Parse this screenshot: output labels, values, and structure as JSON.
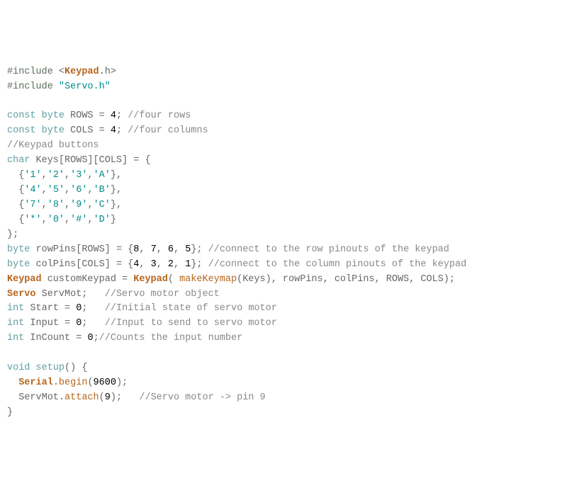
{
  "lines": [
    [
      [
        "preproc",
        "#include"
      ],
      [
        "ident",
        " "
      ],
      [
        "ltgt",
        "<"
      ],
      [
        "cls",
        "Keypad"
      ],
      [
        "ident",
        ".h"
      ],
      [
        "ltgt",
        ">"
      ]
    ],
    [
      [
        "preproc",
        "#include"
      ],
      [
        "ident",
        " "
      ],
      [
        "str",
        "\"Servo.h\""
      ]
    ],
    [],
    [
      [
        "kw",
        "const"
      ],
      [
        "ident",
        " "
      ],
      [
        "kw",
        "byte"
      ],
      [
        "ident",
        " ROWS "
      ],
      [
        "op",
        "="
      ],
      [
        "ident",
        " "
      ],
      [
        "num",
        "4"
      ],
      [
        "op",
        ";"
      ],
      [
        "ident",
        " "
      ],
      [
        "comment",
        "//four rows"
      ]
    ],
    [
      [
        "kw",
        "const"
      ],
      [
        "ident",
        " "
      ],
      [
        "kw",
        "byte"
      ],
      [
        "ident",
        " COLS "
      ],
      [
        "op",
        "="
      ],
      [
        "ident",
        " "
      ],
      [
        "num",
        "4"
      ],
      [
        "op",
        ";"
      ],
      [
        "ident",
        " "
      ],
      [
        "comment",
        "//four columns"
      ]
    ],
    [
      [
        "comment",
        "//Keypad buttons"
      ]
    ],
    [
      [
        "kw",
        "char"
      ],
      [
        "ident",
        " Keys[ROWS][COLS] "
      ],
      [
        "op",
        "="
      ],
      [
        "ident",
        " "
      ],
      [
        "op",
        "{"
      ]
    ],
    [
      [
        "ident",
        "  "
      ],
      [
        "op",
        "{"
      ],
      [
        "str",
        "'1'"
      ],
      [
        "op",
        ","
      ],
      [
        "str",
        "'2'"
      ],
      [
        "op",
        ","
      ],
      [
        "str",
        "'3'"
      ],
      [
        "op",
        ","
      ],
      [
        "str",
        "'A'"
      ],
      [
        "op",
        "},"
      ]
    ],
    [
      [
        "ident",
        "  "
      ],
      [
        "op",
        "{"
      ],
      [
        "str",
        "'4'"
      ],
      [
        "op",
        ","
      ],
      [
        "str",
        "'5'"
      ],
      [
        "op",
        ","
      ],
      [
        "str",
        "'6'"
      ],
      [
        "op",
        ","
      ],
      [
        "str",
        "'B'"
      ],
      [
        "op",
        "},"
      ]
    ],
    [
      [
        "ident",
        "  "
      ],
      [
        "op",
        "{"
      ],
      [
        "str",
        "'7'"
      ],
      [
        "op",
        ","
      ],
      [
        "str",
        "'8'"
      ],
      [
        "op",
        ","
      ],
      [
        "str",
        "'9'"
      ],
      [
        "op",
        ","
      ],
      [
        "str",
        "'C'"
      ],
      [
        "op",
        "},"
      ]
    ],
    [
      [
        "ident",
        "  "
      ],
      [
        "op",
        "{"
      ],
      [
        "str",
        "'*'"
      ],
      [
        "op",
        ","
      ],
      [
        "str",
        "'0'"
      ],
      [
        "op",
        ","
      ],
      [
        "str",
        "'#'"
      ],
      [
        "op",
        ","
      ],
      [
        "str",
        "'D'"
      ],
      [
        "op",
        "}"
      ]
    ],
    [
      [
        "op",
        "};"
      ]
    ],
    [
      [
        "kw",
        "byte"
      ],
      [
        "ident",
        " rowPins[ROWS] "
      ],
      [
        "op",
        "="
      ],
      [
        "ident",
        " "
      ],
      [
        "op",
        "{"
      ],
      [
        "num",
        "8"
      ],
      [
        "op",
        ", "
      ],
      [
        "num",
        "7"
      ],
      [
        "op",
        ", "
      ],
      [
        "num",
        "6"
      ],
      [
        "op",
        ", "
      ],
      [
        "num",
        "5"
      ],
      [
        "op",
        "};"
      ],
      [
        "ident",
        " "
      ],
      [
        "comment",
        "//connect to the row pinouts of the keypad"
      ]
    ],
    [
      [
        "kw",
        "byte"
      ],
      [
        "ident",
        " colPins[COLS] "
      ],
      [
        "op",
        "="
      ],
      [
        "ident",
        " "
      ],
      [
        "op",
        "{"
      ],
      [
        "num",
        "4"
      ],
      [
        "op",
        ", "
      ],
      [
        "num",
        "3"
      ],
      [
        "op",
        ", "
      ],
      [
        "num",
        "2"
      ],
      [
        "op",
        ", "
      ],
      [
        "num",
        "1"
      ],
      [
        "op",
        "};"
      ],
      [
        "ident",
        " "
      ],
      [
        "comment",
        "//connect to the column pinouts of the keypad"
      ]
    ],
    [
      [
        "cls",
        "Keypad"
      ],
      [
        "ident",
        " customKeypad "
      ],
      [
        "op",
        "="
      ],
      [
        "ident",
        " "
      ],
      [
        "cls",
        "Keypad"
      ],
      [
        "op",
        "( "
      ],
      [
        "fn",
        "makeKeymap"
      ],
      [
        "op",
        "("
      ],
      [
        "ident",
        "Keys"
      ],
      [
        "op",
        "), "
      ],
      [
        "ident",
        "rowPins"
      ],
      [
        "op",
        ", "
      ],
      [
        "ident",
        "colPins"
      ],
      [
        "op",
        ", "
      ],
      [
        "ident",
        "ROWS"
      ],
      [
        "op",
        ", "
      ],
      [
        "ident",
        "COLS"
      ],
      [
        "op",
        ");"
      ]
    ],
    [
      [
        "cls",
        "Servo"
      ],
      [
        "ident",
        " ServMot"
      ],
      [
        "op",
        ";"
      ],
      [
        "ident",
        "   "
      ],
      [
        "comment",
        "//Servo motor object"
      ]
    ],
    [
      [
        "kw",
        "int"
      ],
      [
        "ident",
        " Start "
      ],
      [
        "op",
        "="
      ],
      [
        "ident",
        " "
      ],
      [
        "num",
        "0"
      ],
      [
        "op",
        ";"
      ],
      [
        "ident",
        "   "
      ],
      [
        "comment",
        "//Initial state of servo motor"
      ]
    ],
    [
      [
        "kw",
        "int"
      ],
      [
        "ident",
        " Input "
      ],
      [
        "op",
        "="
      ],
      [
        "ident",
        " "
      ],
      [
        "num",
        "0"
      ],
      [
        "op",
        ";"
      ],
      [
        "ident",
        "   "
      ],
      [
        "comment",
        "//Input to send to servo motor"
      ]
    ],
    [
      [
        "kw",
        "int"
      ],
      [
        "ident",
        " InCount "
      ],
      [
        "op",
        "="
      ],
      [
        "ident",
        " "
      ],
      [
        "num",
        "0"
      ],
      [
        "op",
        ";"
      ],
      [
        "comment",
        "//Counts the input number"
      ]
    ],
    [],
    [
      [
        "kw",
        "void"
      ],
      [
        "ident",
        " "
      ],
      [
        "kw",
        "setup"
      ],
      [
        "op",
        "() {"
      ]
    ],
    [
      [
        "ident",
        "  "
      ],
      [
        "cls",
        "Serial"
      ],
      [
        "op",
        "."
      ],
      [
        "fn",
        "begin"
      ],
      [
        "op",
        "("
      ],
      [
        "num",
        "9600"
      ],
      [
        "op",
        ");"
      ]
    ],
    [
      [
        "ident",
        "  ServMot"
      ],
      [
        "op",
        "."
      ],
      [
        "fn",
        "attach"
      ],
      [
        "op",
        "("
      ],
      [
        "num",
        "9"
      ],
      [
        "op",
        ");"
      ],
      [
        "ident",
        "   "
      ],
      [
        "comment",
        "//Servo motor -> pin 9"
      ]
    ],
    [
      [
        "op",
        "}"
      ]
    ]
  ]
}
